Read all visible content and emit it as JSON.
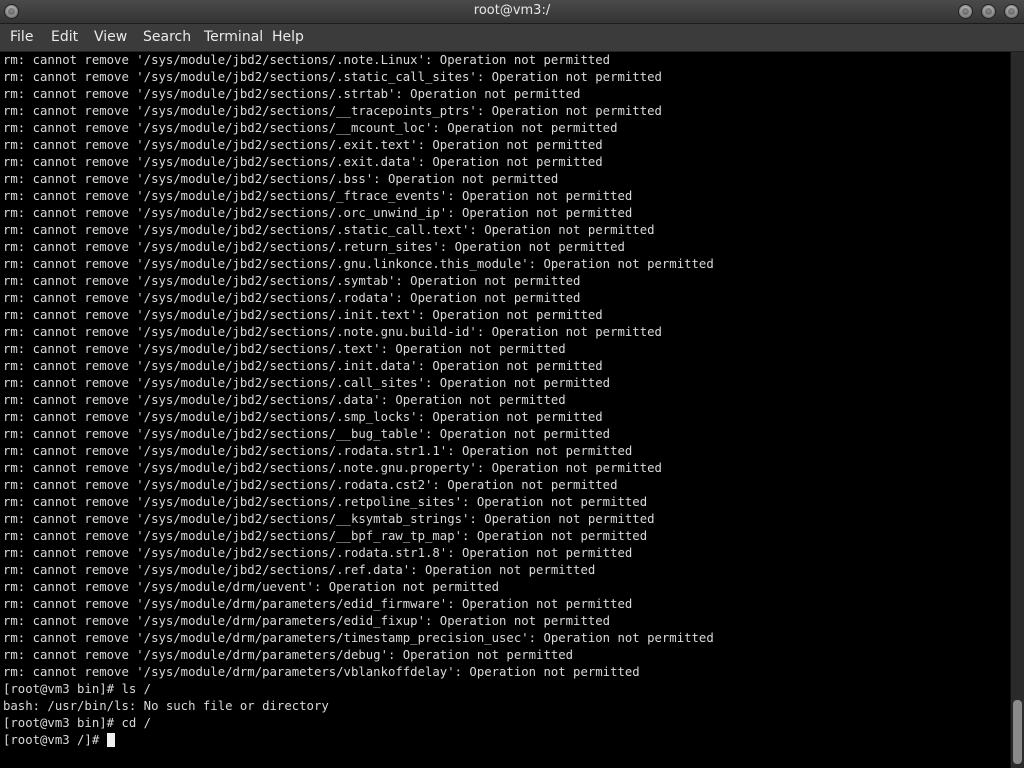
{
  "window": {
    "title": "root@vm3:/"
  },
  "menu": {
    "file": "File",
    "edit": "Edit",
    "view": "View",
    "search": "Search",
    "terminal": "Terminal",
    "help": "Help"
  },
  "terminal": {
    "lines": [
      "rm: cannot remove '/sys/module/jbd2/sections/.note.Linux': Operation not permitted",
      "rm: cannot remove '/sys/module/jbd2/sections/.static_call_sites': Operation not permitted",
      "rm: cannot remove '/sys/module/jbd2/sections/.strtab': Operation not permitted",
      "rm: cannot remove '/sys/module/jbd2/sections/__tracepoints_ptrs': Operation not permitted",
      "rm: cannot remove '/sys/module/jbd2/sections/__mcount_loc': Operation not permitted",
      "rm: cannot remove '/sys/module/jbd2/sections/.exit.text': Operation not permitted",
      "rm: cannot remove '/sys/module/jbd2/sections/.exit.data': Operation not permitted",
      "rm: cannot remove '/sys/module/jbd2/sections/.bss': Operation not permitted",
      "rm: cannot remove '/sys/module/jbd2/sections/_ftrace_events': Operation not permitted",
      "rm: cannot remove '/sys/module/jbd2/sections/.orc_unwind_ip': Operation not permitted",
      "rm: cannot remove '/sys/module/jbd2/sections/.static_call.text': Operation not permitted",
      "rm: cannot remove '/sys/module/jbd2/sections/.return_sites': Operation not permitted",
      "rm: cannot remove '/sys/module/jbd2/sections/.gnu.linkonce.this_module': Operation not permitted",
      "rm: cannot remove '/sys/module/jbd2/sections/.symtab': Operation not permitted",
      "rm: cannot remove '/sys/module/jbd2/sections/.rodata': Operation not permitted",
      "rm: cannot remove '/sys/module/jbd2/sections/.init.text': Operation not permitted",
      "rm: cannot remove '/sys/module/jbd2/sections/.note.gnu.build-id': Operation not permitted",
      "rm: cannot remove '/sys/module/jbd2/sections/.text': Operation not permitted",
      "rm: cannot remove '/sys/module/jbd2/sections/.init.data': Operation not permitted",
      "rm: cannot remove '/sys/module/jbd2/sections/.call_sites': Operation not permitted",
      "rm: cannot remove '/sys/module/jbd2/sections/.data': Operation not permitted",
      "rm: cannot remove '/sys/module/jbd2/sections/.smp_locks': Operation not permitted",
      "rm: cannot remove '/sys/module/jbd2/sections/__bug_table': Operation not permitted",
      "rm: cannot remove '/sys/module/jbd2/sections/.rodata.str1.1': Operation not permitted",
      "rm: cannot remove '/sys/module/jbd2/sections/.note.gnu.property': Operation not permitted",
      "rm: cannot remove '/sys/module/jbd2/sections/.rodata.cst2': Operation not permitted",
      "rm: cannot remove '/sys/module/jbd2/sections/.retpoline_sites': Operation not permitted",
      "rm: cannot remove '/sys/module/jbd2/sections/__ksymtab_strings': Operation not permitted",
      "rm: cannot remove '/sys/module/jbd2/sections/__bpf_raw_tp_map': Operation not permitted",
      "rm: cannot remove '/sys/module/jbd2/sections/.rodata.str1.8': Operation not permitted",
      "rm: cannot remove '/sys/module/jbd2/sections/.ref.data': Operation not permitted",
      "rm: cannot remove '/sys/module/drm/uevent': Operation not permitted",
      "rm: cannot remove '/sys/module/drm/parameters/edid_firmware': Operation not permitted",
      "rm: cannot remove '/sys/module/drm/parameters/edid_fixup': Operation not permitted",
      "rm: cannot remove '/sys/module/drm/parameters/timestamp_precision_usec': Operation not permitted",
      "rm: cannot remove '/sys/module/drm/parameters/debug': Operation not permitted",
      "rm: cannot remove '/sys/module/drm/parameters/vblankoffdelay': Operation not permitted",
      "[root@vm3 bin]# ls /",
      "bash: /usr/bin/ls: No such file or directory",
      "[root@vm3 bin]# cd /"
    ],
    "prompt": "[root@vm3 /]# "
  }
}
